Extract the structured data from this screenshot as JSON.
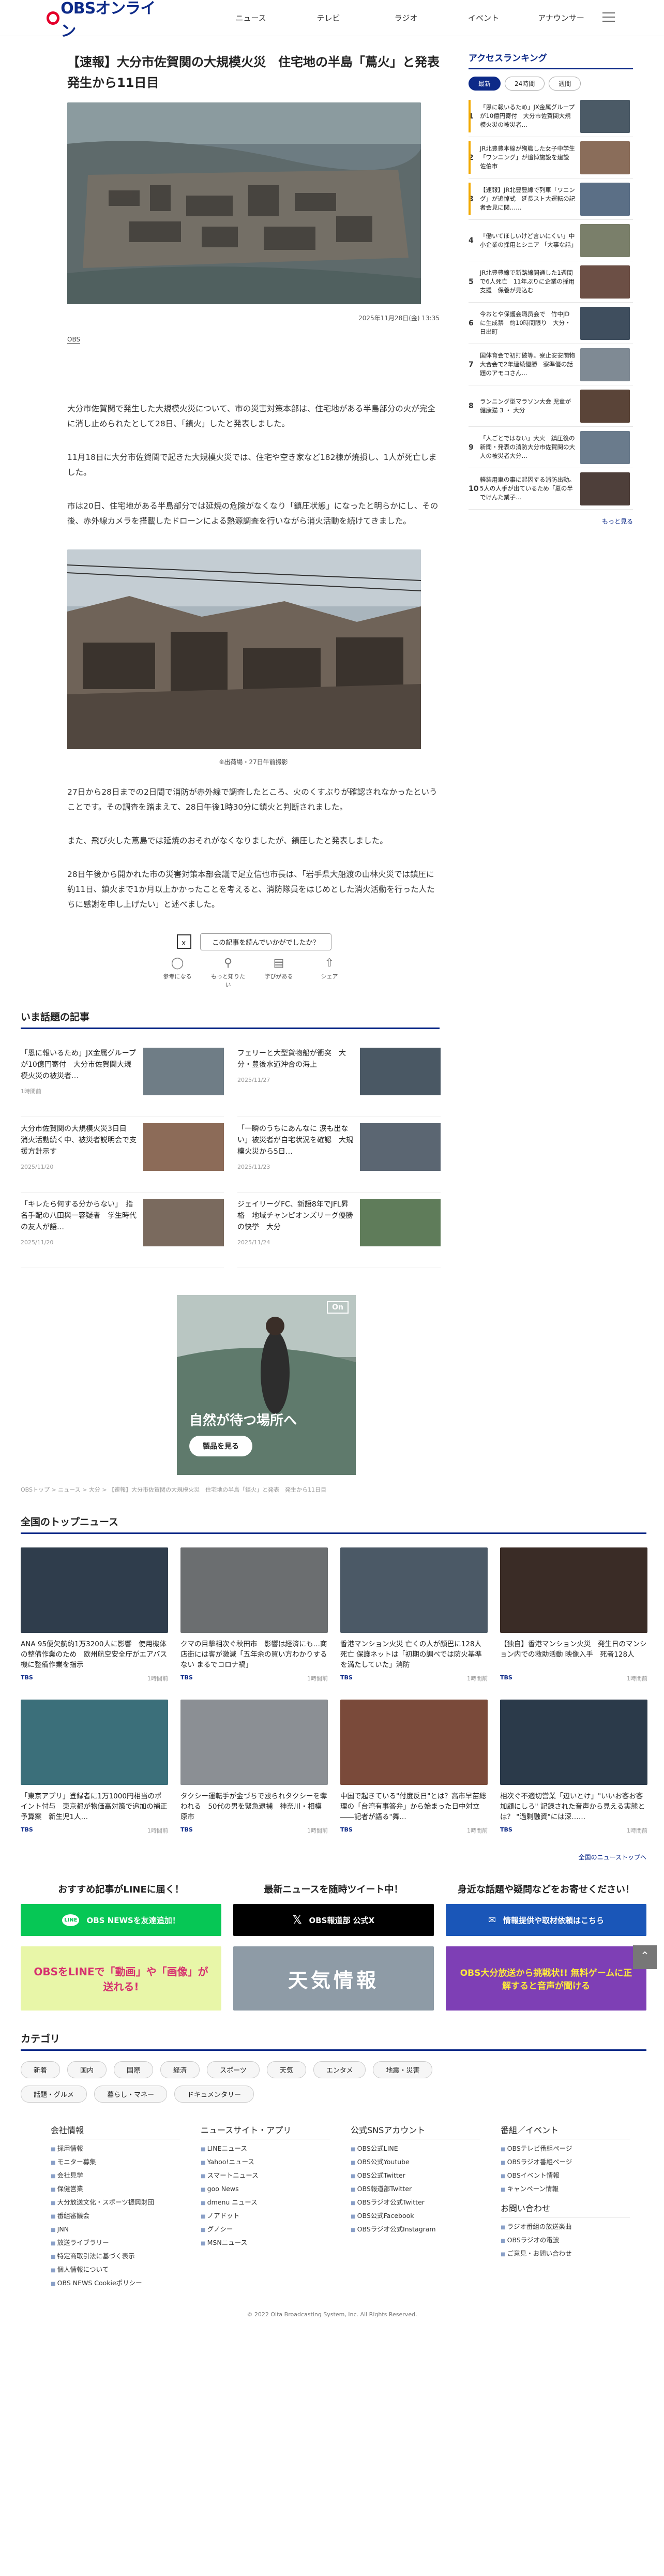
{
  "header": {
    "logo_text": "OBSオンライン",
    "nav": [
      "ニュース",
      "テレビ",
      "ラジオ",
      "イベント",
      "アナウンサー"
    ]
  },
  "article": {
    "title": "【速報】大分市佐賀関の大規模火災　住宅地の半島「蔦火」と発表　発生から11日目",
    "datetime": "2025年11月28日(金) 13:35",
    "source": "OBS",
    "paragraphs": [
      "大分市佐賀関で発生した大規模火災について、市の災害対策本部は、住宅地がある半島部分の火が完全に消し止められたとして28日、「鎮火」したと発表しました。",
      "11月18日に大分市佐賀関で起きた大規模火災では、住宅や空き家など182棟が焼損し、1人が死亡しました。",
      "市は20日、住宅地がある半島部分では延焼の危険がなくなり「鎮圧状態」になったと明らかにし、その後、赤外線カメラを搭載したドローンによる熱源調査を行いながら消火活動を続けてきました。"
    ],
    "photo2_caption": "※出荷場・27日午前撮影",
    "paragraphs2": [
      "27日から28日までの2日間で消防が赤外線で調査したところ、火のくすぶりが確認されなかったということです。その調査を踏まえて、28日午後1時30分に鎮火と判断されました。",
      "また、飛び火した蔦島では延焼のおそれがなくなりましたが、鎮圧したと発表しました。",
      "28日午後から開かれた市の災害対策本部会議で足立信也市長は、「岩手県大船渡の山林火災では鎮圧に約11日、鎮火まで1か月以上かかったことを考えると、消防隊員をはじめとした消火活動を行った人たちに感謝を申し上げたい」と述べました。"
    ],
    "feedback_q": "この記事を読んでいかがでしたか？",
    "reactions": [
      "参考になる",
      "もっと知りたい",
      "学びがある",
      "シェア"
    ]
  },
  "ranking": {
    "title": "アクセスランキング",
    "tabs": [
      "最新",
      "24時間",
      "週間"
    ],
    "items": [
      {
        "n": "1",
        "t": "「恩に報いるため」JX金属グループが10億円寄付　大分市佐賀関大規模火災の被災者…"
      },
      {
        "n": "2",
        "t": "JR北豊豊本線が殉職した女子中学生「ワンニング」が追悼施設を建設 佐伯市"
      },
      {
        "n": "3",
        "t": "【速報】JR北豊豊線で列車「ワニング」が追悼式　延長スト大運転の記者会見に関……"
      },
      {
        "n": "4",
        "t": "「働いてほしいけど言いにくい」中小企業の採用とシニア 「大事な話」"
      },
      {
        "n": "5",
        "t": "JR北豊豊線で新路線開通した1週間で6人死亡　11年ぶりに企業の採用支援　保養が見込む"
      },
      {
        "n": "6",
        "t": "今おとや保護会職员会で　竹中JDに生成禁　約10時間限り　大分・日出町"
      },
      {
        "n": "7",
        "t": "国体育会で初打破等。寮止安安関物大合会で2年連続優勝　寮準優の話題のアモコさん…"
      },
      {
        "n": "8",
        "t": "ランニング型マラソン大会 児童が健康猫 3 ・ 大分"
      },
      {
        "n": "9",
        "t": "「人ごとではない」大火　鎮圧後の新聞・発表の消防大分市佐賀関の大人の被災者大分…"
      },
      {
        "n": "10",
        "t": "軽装用車の事に起因する消防出動。5人の人手が出ているため「夏の半でけんた業子…"
      }
    ],
    "more": "もっと見る"
  },
  "topics": {
    "title": "いま話題の記事",
    "items": [
      {
        "t": "「恩に報いるため」JX金属グループが10億円寄付　大分市佐賀関大規模火災の被災者…",
        "d": "1時間前"
      },
      {
        "t": "フェリーと大型貨物船が衝突　大分・豊後水道沖合の海上",
        "d": "2025/11/27"
      },
      {
        "t": "大分市佐賀関の大規模火災3日目　消火活動続く中、被災者説明会で支援方針示す",
        "d": "2025/11/20"
      },
      {
        "t": "「一瞬のうちにあんなに 涙も出ない」被災者が自宅状況を確認　大規模火災から5日…",
        "d": "2025/11/23"
      },
      {
        "t": "「キレたら何する分からない」　指名手配の八田與一容疑者　学生時代の友人が語…",
        "d": "2025/11/20"
      },
      {
        "t": "ジェイリーグFC、新語8年でJFL昇格　地域チャンピオンズリーグ優勝の快挙　大分",
        "d": "2025/11/24"
      }
    ]
  },
  "ad": {
    "copy": "自然が待つ場所へ",
    "button": "製品を見る",
    "badge": "On"
  },
  "breadcrumb": "OBSトップ > ニュース > 大分 > 【速報】大分市佐賀関の大規模火災　住宅地の半島「鎮火」と発表　発生から11日目",
  "top_news": {
    "title": "全国のトップニュース",
    "items": [
      {
        "t": "ANA 95便欠航約1万3200人に影響　使用機体の整備作業のため　欧州航空安全庁がエアバス機に整備作業を指示",
        "src": "TBS",
        "d": "1時間前"
      },
      {
        "t": "クマの目撃相次ぐ秋田市　影響は経済にも…商店街には客が激減「五年余の買い方わかりするない まるでコロナ禍」",
        "src": "TBS",
        "d": "1時間前"
      },
      {
        "t": "香港マンション火災 亡くの人が顔巴に128人死亡 保護ネットは「初期の調べでは防火基準を満たしていた」消防",
        "src": "TBS",
        "d": "1時間前"
      },
      {
        "t": "【独自】香港マンション火災　発生日のマンション内での救助活動 映像入手　死者128人",
        "src": "TBS",
        "d": "1時間前"
      },
      {
        "t": "「東京アプリ」登録者に1万1000円相当のポイント付与　東京都が物価高対策で追加の補正予算案　新生児1人…",
        "src": "TBS",
        "d": "1時間前"
      },
      {
        "t": "タクシー運転手が金づちで殴られタクシーを奪われる　50代の男を緊急逮捕　神奈川・相模原市",
        "src": "TBS",
        "d": "1時間前"
      },
      {
        "t": "中国で起きている\"付度反日\"とは？高市早苗総理の「台湾有事答弁」から始まった日中対立――記者が語る\"舞…",
        "src": "TBS",
        "d": "1時間前"
      },
      {
        "t": "相次ぐ不適切営業「辺いとけ」\"いいお客お客加顧にしろ\" 記録された音声から見える実態とは？ \"過剰融資\"には深……",
        "src": "TBS",
        "d": "1時間前"
      }
    ],
    "more": "全国のニューストップへ"
  },
  "cta": [
    {
      "h": "おすすめ記事がLINEに届く！",
      "btn": "OBS NEWSを友達追加！",
      "ban": "OBSをLINEで「動画」や「画像」が送れる!"
    },
    {
      "h": "最新ニュースを随時ツイート中！",
      "btn": "OBS報道部 公式X",
      "ban": "天気情報"
    },
    {
      "h": "身近な話題や疑問などをお寄せください！",
      "btn": "情報提供や取材依頼はこちら",
      "ban": "OBS大分放送から挑戦状!! 無料ゲームに正解すると音声が聞ける"
    }
  ],
  "categories": {
    "title": "カテゴリ",
    "items": [
      "新着",
      "国内",
      "国際",
      "経済",
      "スポーツ",
      "天気",
      "エンタメ",
      "地震・災害",
      "話題・グルメ",
      "暮らし・マネー",
      "ドキュメンタリー"
    ]
  },
  "footer": {
    "cols": [
      {
        "h": "会社情報",
        "items": [
          "採用情報",
          "モニター募集",
          "会社見学",
          "保健営業",
          "大分放送文化・スポーツ振興財団",
          "番組審議会",
          "JNN",
          "放送ライブラリー",
          "特定商取引法に基づく表示",
          "個人情報について",
          "OBS NEWS Cookieポリシー"
        ]
      },
      {
        "h": "ニュースサイト・アプリ",
        "items": [
          "LINEニュース",
          "Yahoo!ニュース",
          "スマートニュース",
          "goo News",
          "dmenu ニュース",
          "ノアドット",
          "グノシー",
          "MSNニュース"
        ]
      },
      {
        "h": "公式SNSアカウント",
        "items": [
          "OBS公式LINE",
          "OBS公式Youtube",
          "OBS公式Twitter",
          "OBS報道部Twitter",
          "OBSラジオ公式Twitter",
          "OBS公式Facebook",
          "OBSラジオ公式Instagram"
        ]
      },
      {
        "h": "番組／イベント",
        "items": [
          "OBSテレビ番組ページ",
          "OBSラジオ番組ページ",
          "OBSイベント情報",
          "キャンペーン情報"
        ],
        "h2": "お問い合わせ",
        "items2": [
          "ラジオ番組の放送楽曲",
          "OBSラジオの電波",
          "ご意見・お問い合わせ"
        ]
      }
    ],
    "copyright": "© 2022 Oita Broadcasting System, Inc. All Rights Reserved."
  }
}
